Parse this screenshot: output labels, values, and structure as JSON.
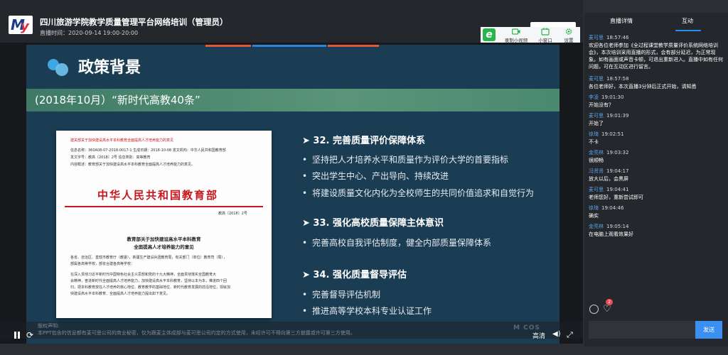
{
  "header": {
    "title": "四川旅游学院教学质量管理平台网络培训（管理员）",
    "time_label": "直播时间：2020-09-14 19:00-20:00"
  },
  "toolbar": {
    "app_icon": "e",
    "record_label": "录制小视频",
    "mini_window_label": "小窗口",
    "settings_label": "设置"
  },
  "slide": {
    "title": "政策背景",
    "banner": "(2018年10月）“新时代高教40条”",
    "doc_red_title": "中华人民共和国教育部",
    "doc_number": "教高〔2018〕2号",
    "doc_subtitle": "教育部关于加快建设高水平本科教育\n全面提高人才培养能力的意见",
    "doc_header_red": "建关部关于加快建设高水平本科教育全面提高人才培养能力的意见",
    "doc_header_rows": [
      "信息名称：360A08-07-2018-0017-1  生成日期：2018-10-08  发文机构：中华人民共和国教育部",
      "发文字号：教高〔2018〕2号  信息类别：高等教育",
      "内容概述：教育部关于加快建设高水平本科教育全面提高人才培养能力的意见。"
    ],
    "doc_body": [
      "各省、自治区、直辖市教育厅（教委），新疆生产建设兵团教育局，有关部门（单位）教育司（局），",
      "部属各高等学校，部省合建各高等学校：",
      "",
      "在深入贯彻习近平新时代中国特色社会主义思想和党的十九大精神，全面贯彻落实全国教育大",
      "会精神，奋进新时代全面提高人才培养能力，加快建设高水平本科教育，坚持以本为本，推进四个回",
      "归，把本科教育放在人才培养的核心地位、教育教学的基础地位、新时代教育发展的前沿地位，现就加",
      "快建设高水平本科教育、全面提高人才培养能力提出如下意见。"
    ],
    "sections": [
      {
        "title": "➤ 32. 完善质量评价保障体系",
        "bullets": [
          "坚持把人才培养水平和质量作为评价大学的首要指标",
          "突出学生中心、产出导向、持续改进",
          "将建设质量文化内化为全校师生的共同价值追求和自觉行为"
        ]
      },
      {
        "title": "➤ 33. 强化高校质量保障主体意识",
        "bullets": [
          "完善高校自我评估制度，健全内部质量保障体系"
        ]
      },
      {
        "title": "➤ 34. 强化质量督导评估",
        "bullets": [
          "完善督导评估机制",
          "推进高等学校本科专业认证工作"
        ]
      }
    ]
  },
  "player": {
    "disclaimer_title": "版权声明:",
    "disclaimer_text": "本PPT包含的信息都有麦可思公司的商业秘密，仅为跟麦主体成部与麦可思公司约定的方式使用，未经许可不得向第三方披露或许可第三方使用。",
    "quality_label": "高清",
    "watermark": "M COS"
  },
  "panel": {
    "tabs": [
      "直播详情",
      "互动"
    ],
    "active_tab": "互动",
    "messages": [
      {
        "user": "麦可思",
        "time": "18:57:46",
        "text": "欢迎各位老师参加《全过程课堂教学质量评价系统网络培训会》，本次培训采用直播的形式，会有部分延迟，为正常现象。如有画面或声音卡顿，可退出重新进入。直播中如有任何问题，可在互动区进行留言。"
      },
      {
        "user": "麦可思",
        "time": "18:57:58",
        "text": "各位老师好，本次直播3分钟后正式开始，请知悉"
      },
      {
        "user": "李凌",
        "time": "19:01:30",
        "text": "开始没有？"
      },
      {
        "user": "麦可思",
        "time": "19:01:39",
        "text": "开始了"
      },
      {
        "user": "徐琦",
        "time": "19:02:51",
        "text": "不卡"
      },
      {
        "user": "金亮林",
        "time": "19:03:32",
        "text": "很顺畅"
      },
      {
        "user": "冯贤贤",
        "time": "19:04:17",
        "text": "放大以后，会黑屏"
      },
      {
        "user": "麦可思",
        "time": "19:04:41",
        "text": "老师您好，重新尝试即可"
      },
      {
        "user": "徐琦",
        "time": "19:04:46",
        "text": "确实"
      },
      {
        "user": "金亮林",
        "time": "19:05:14",
        "text": "在电脑上观看效果好"
      }
    ],
    "like_count": "2",
    "input_placeholder": "",
    "send_label": "发送"
  }
}
